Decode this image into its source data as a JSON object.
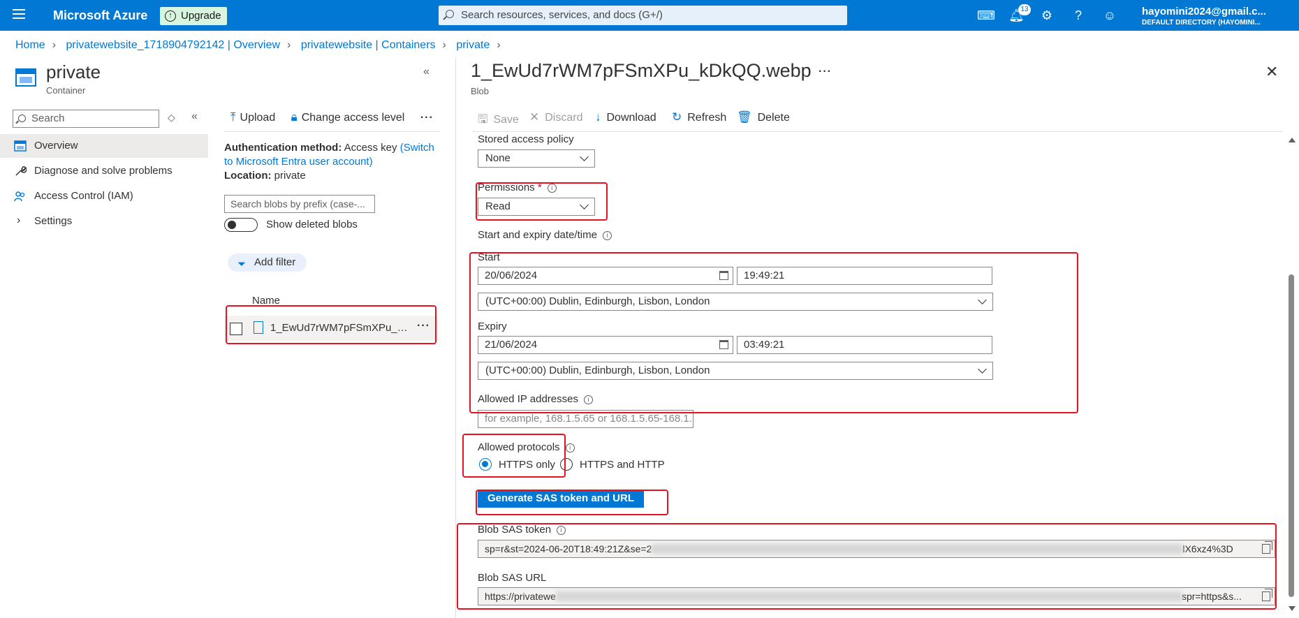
{
  "topbar": {
    "brand": "Microsoft Azure",
    "upgrade": "Upgrade",
    "search_placeholder": "Search resources, services, and docs (G+/)",
    "notification_count": "13",
    "account_email": "hayomini2024@gmail.c...",
    "account_directory": "DEFAULT DIRECTORY (HAYOMINI..."
  },
  "breadcrumb": [
    "Home",
    "privatewebsite_1718904792142 | Overview",
    "privatewebsite | Containers",
    "private"
  ],
  "resource": {
    "title": "private",
    "subtitle": "Container"
  },
  "left_nav": {
    "search_placeholder": "Search",
    "items": [
      "Overview",
      "Diagnose and solve problems",
      "Access Control (IAM)",
      "Settings"
    ]
  },
  "middle": {
    "toolbar": {
      "upload": "Upload",
      "change_access": "Change access level"
    },
    "auth_label": "Authentication method:",
    "auth_value": "Access key",
    "auth_link": "(Switch to Microsoft Entra user account)",
    "location_label": "Location:",
    "location_value": "private",
    "blob_search_placeholder": "Search blobs by prefix (case-...",
    "show_deleted": "Show deleted blobs",
    "add_filter": "Add filter",
    "column_name": "Name",
    "blob_name": "1_EwUd7rWM7pFSmXPu_kDk..."
  },
  "panel": {
    "title": "1_EwUd7rWM7pFSmXPu_kDkQQ.webp",
    "subtitle": "Blob",
    "toolbar": {
      "save": "Save",
      "discard": "Discard",
      "download": "Download",
      "refresh": "Refresh",
      "delete": "Delete"
    },
    "stored_policy_label": "Stored access policy",
    "stored_policy_value": "None",
    "permissions_label": "Permissions",
    "permissions_required": "*",
    "permissions_value": "Read",
    "date_section_label": "Start and expiry date/time",
    "start_label": "Start",
    "start_date": "20/06/2024",
    "start_time": "19:49:21",
    "start_tz": "(UTC+00:00) Dublin, Edinburgh, Lisbon, London",
    "expiry_label": "Expiry",
    "expiry_date": "21/06/2024",
    "expiry_time": "03:49:21",
    "expiry_tz": "(UTC+00:00) Dublin, Edinburgh, Lisbon, London",
    "ip_label": "Allowed IP addresses",
    "ip_placeholder": "for example, 168.1.5.65 or 168.1.5.65-168.1....",
    "protocols_label": "Allowed protocols",
    "protocol_https_only": "HTTPS only",
    "protocol_https_http": "HTTPS and HTTP",
    "generate_button": "Generate SAS token and URL",
    "sas_token_label": "Blob SAS token",
    "sas_token_start": "sp=r&st=2024-06-20T18:49:21Z&se=2",
    "sas_token_end": "lX6xz4%3D",
    "sas_url_label": "Blob SAS URL",
    "sas_url_start": "https://privatewe",
    "sas_url_end": "spr=https&s..."
  },
  "colors": {
    "accent": "#0078d4",
    "annotation": "#e81123"
  }
}
